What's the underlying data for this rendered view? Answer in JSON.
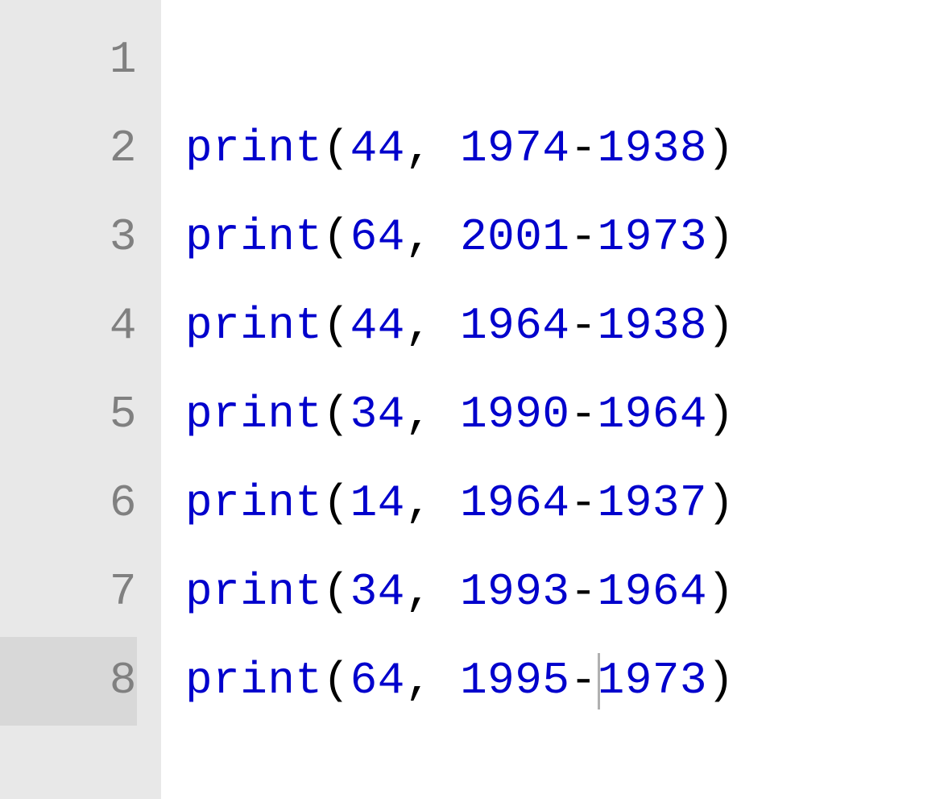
{
  "editor": {
    "gutter": {
      "numbers": [
        "1",
        "2",
        "3",
        "4",
        "5",
        "6",
        "7",
        "8"
      ]
    },
    "current_line_index": 7,
    "caret": {
      "line_index": 7,
      "token_index": 6
    },
    "lines": [
      [],
      [
        {
          "t": "print",
          "cls": "fn"
        },
        {
          "t": "(",
          "cls": "punct"
        },
        {
          "t": "44",
          "cls": "num"
        },
        {
          "t": ", ",
          "cls": "punct"
        },
        {
          "t": "1974",
          "cls": "num"
        },
        {
          "t": "-",
          "cls": "op"
        },
        {
          "t": "1938",
          "cls": "num"
        },
        {
          "t": ")",
          "cls": "punct"
        }
      ],
      [
        {
          "t": "print",
          "cls": "fn"
        },
        {
          "t": "(",
          "cls": "punct"
        },
        {
          "t": "64",
          "cls": "num"
        },
        {
          "t": ", ",
          "cls": "punct"
        },
        {
          "t": "2001",
          "cls": "num"
        },
        {
          "t": "-",
          "cls": "op"
        },
        {
          "t": "1973",
          "cls": "num"
        },
        {
          "t": ")",
          "cls": "punct"
        }
      ],
      [
        {
          "t": "print",
          "cls": "fn"
        },
        {
          "t": "(",
          "cls": "punct"
        },
        {
          "t": "44",
          "cls": "num"
        },
        {
          "t": ", ",
          "cls": "punct"
        },
        {
          "t": "1964",
          "cls": "num"
        },
        {
          "t": "-",
          "cls": "op"
        },
        {
          "t": "1938",
          "cls": "num"
        },
        {
          "t": ")",
          "cls": "punct"
        }
      ],
      [
        {
          "t": "print",
          "cls": "fn"
        },
        {
          "t": "(",
          "cls": "punct"
        },
        {
          "t": "34",
          "cls": "num"
        },
        {
          "t": ", ",
          "cls": "punct"
        },
        {
          "t": "1990",
          "cls": "num"
        },
        {
          "t": "-",
          "cls": "op"
        },
        {
          "t": "1964",
          "cls": "num"
        },
        {
          "t": ")",
          "cls": "punct"
        }
      ],
      [
        {
          "t": "print",
          "cls": "fn"
        },
        {
          "t": "(",
          "cls": "punct"
        },
        {
          "t": "14",
          "cls": "num"
        },
        {
          "t": ", ",
          "cls": "punct"
        },
        {
          "t": "1964",
          "cls": "num"
        },
        {
          "t": "-",
          "cls": "op"
        },
        {
          "t": "1937",
          "cls": "num"
        },
        {
          "t": ")",
          "cls": "punct"
        }
      ],
      [
        {
          "t": "print",
          "cls": "fn"
        },
        {
          "t": "(",
          "cls": "punct"
        },
        {
          "t": "34",
          "cls": "num"
        },
        {
          "t": ", ",
          "cls": "punct"
        },
        {
          "t": "1993",
          "cls": "num"
        },
        {
          "t": "-",
          "cls": "op"
        },
        {
          "t": "1964",
          "cls": "num"
        },
        {
          "t": ")",
          "cls": "punct"
        }
      ],
      [
        {
          "t": "print",
          "cls": "fn"
        },
        {
          "t": "(",
          "cls": "punct"
        },
        {
          "t": "64",
          "cls": "num"
        },
        {
          "t": ", ",
          "cls": "punct"
        },
        {
          "t": "1995",
          "cls": "num"
        },
        {
          "t": "-",
          "cls": "op"
        },
        {
          "t": "1973",
          "cls": "num"
        },
        {
          "t": ")",
          "cls": "punct"
        }
      ]
    ]
  }
}
